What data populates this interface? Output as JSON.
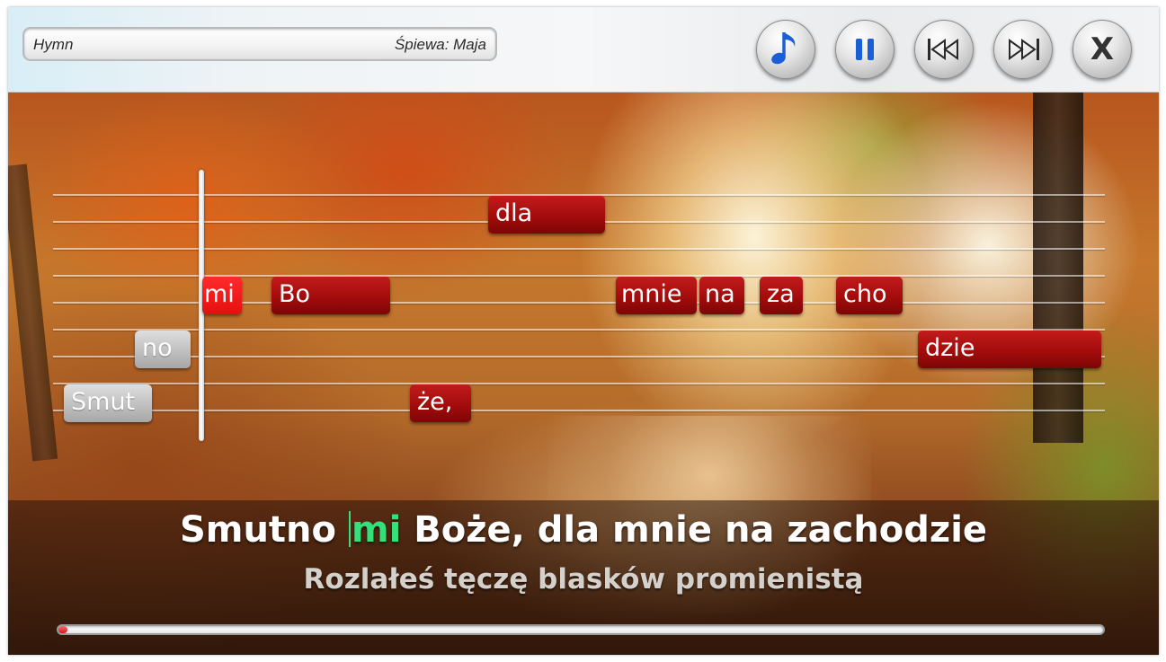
{
  "header": {
    "song_title": "Hymn",
    "singer": "Śpiewa: Maja"
  },
  "controls": [
    {
      "name": "music-note-icon",
      "label": "music"
    },
    {
      "name": "pause-icon",
      "label": "pause"
    },
    {
      "name": "previous-icon",
      "label": "previous"
    },
    {
      "name": "next-icon",
      "label": "next"
    },
    {
      "name": "close-icon",
      "label": "X"
    }
  ],
  "notes": [
    {
      "text": "Smut",
      "state": "sung"
    },
    {
      "text": "no",
      "state": "sung"
    },
    {
      "text": "mi",
      "state": "active"
    },
    {
      "text": "Bo",
      "state": "upcoming"
    },
    {
      "text": "że,",
      "state": "upcoming"
    },
    {
      "text": "dla",
      "state": "upcoming"
    },
    {
      "text": "mnie",
      "state": "upcoming"
    },
    {
      "text": "na",
      "state": "upcoming"
    },
    {
      "text": "za",
      "state": "upcoming"
    },
    {
      "text": "cho",
      "state": "upcoming"
    },
    {
      "text": "dzie",
      "state": "upcoming"
    }
  ],
  "lyrics": {
    "current_before": "Smutno ",
    "current_highlight": "mi",
    "current_after": " Boże, dla mnie na zachodzie",
    "next_line": "Rozlałeś tęczę blasków promienistą"
  },
  "playback": {
    "progress_fraction": 0.004
  },
  "colors": {
    "accent_red": "#b00f0f",
    "active_red": "#f01818",
    "highlight_green": "#35e07a",
    "icon_blue": "#1a5fd8"
  }
}
